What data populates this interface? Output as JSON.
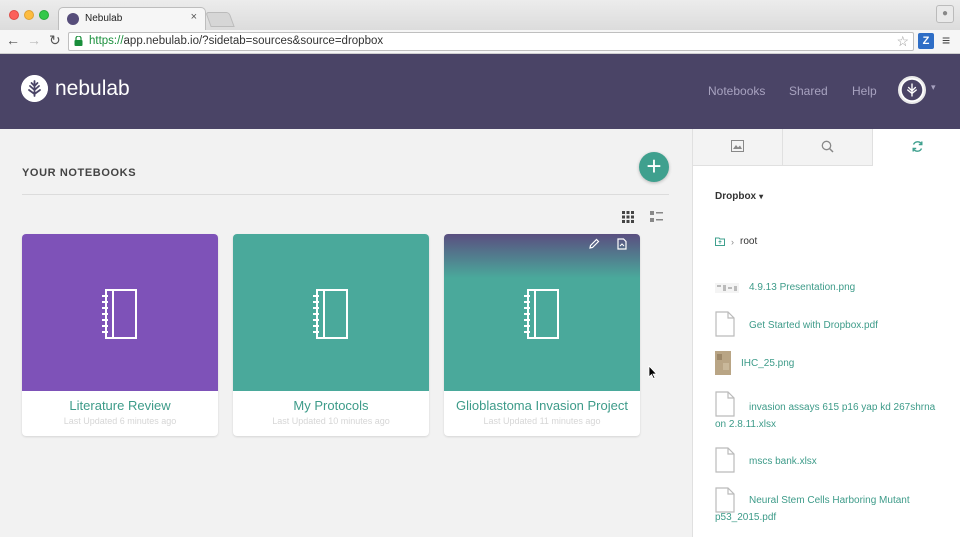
{
  "browser": {
    "tab_title": "Nebulab",
    "tab_close": "×",
    "url_scheme": "https://",
    "url_rest": "app.nebulab.io/?sidetab=sources&source=dropbox",
    "ext_label": "Z"
  },
  "header": {
    "logo_text": "nebulab",
    "nav": [
      "Notebooks",
      "Shared",
      "Help"
    ],
    "bg_color": "#4a4466"
  },
  "main": {
    "section_title": "YOUR NOTEBOOKS",
    "add_label": "+",
    "notebooks": [
      {
        "title": "Literature Review",
        "updated": "Last Updated 6 minutes ago",
        "color": "#7e52b8"
      },
      {
        "title": "My Protocols",
        "updated": "Last Updated 10 minutes ago",
        "color": "#4aa99b"
      },
      {
        "title": "Glioblastoma Invasion Project",
        "updated": "Last Updated 11 minutes ago",
        "color": "#4aa99b"
      }
    ]
  },
  "side": {
    "source": "Dropbox",
    "breadcrumb_root": "root",
    "files": [
      {
        "name": "4.9.13 Presentation.png",
        "icon": "image-thumb-icon"
      },
      {
        "name": "Get Started with Dropbox.pdf",
        "icon": "document-icon"
      },
      {
        "name": "IHC_25.png",
        "icon": "image-thumb-icon"
      },
      {
        "name_line1": "invasion assays 615 p16 yap kd 267shrna",
        "name_line2": "on 2.8.11.xlsx",
        "icon": "document-icon"
      },
      {
        "name": "mscs bank.xlsx",
        "icon": "document-icon"
      },
      {
        "name_line1": "Neural Stem Cells Harboring Mutant",
        "name_line2": "p53_2015.pdf",
        "icon": "document-icon"
      }
    ],
    "accent": "#3fa08e"
  }
}
